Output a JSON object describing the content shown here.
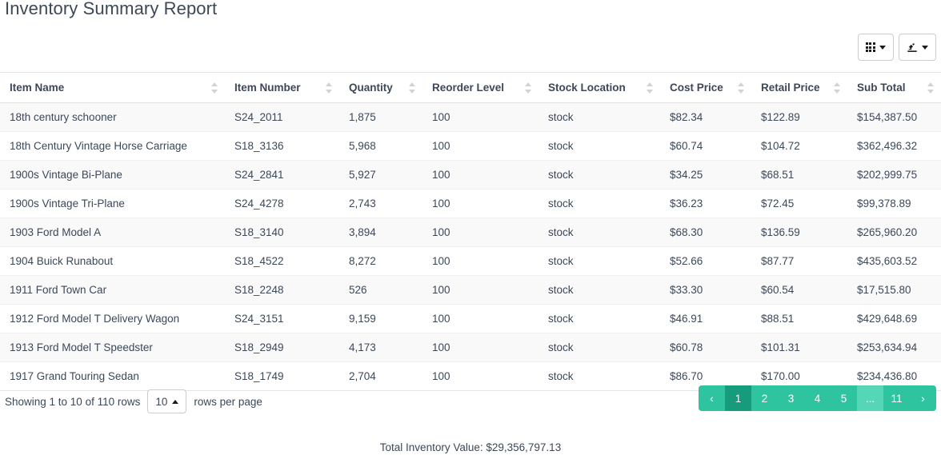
{
  "page_title": "Inventory Summary Report",
  "toolbar": {
    "columns_button": {
      "icon": "grid-icon",
      "caret": "chevron-down-icon"
    },
    "export_button": {
      "icon": "export-icon",
      "caret": "chevron-down-icon"
    }
  },
  "table": {
    "columns": [
      "Item Name",
      "Item Number",
      "Quantity",
      "Reorder Level",
      "Stock Location",
      "Cost Price",
      "Retail Price",
      "Sub Total"
    ],
    "rows": [
      [
        "18th century schooner",
        "S24_2011",
        "1,875",
        "100",
        "stock",
        "$82.34",
        "$122.89",
        "$154,387.50"
      ],
      [
        "18th Century Vintage Horse Carriage",
        "S18_3136",
        "5,968",
        "100",
        "stock",
        "$60.74",
        "$104.72",
        "$362,496.32"
      ],
      [
        "1900s Vintage Bi-Plane",
        "S24_2841",
        "5,927",
        "100",
        "stock",
        "$34.25",
        "$68.51",
        "$202,999.75"
      ],
      [
        "1900s Vintage Tri-Plane",
        "S24_4278",
        "2,743",
        "100",
        "stock",
        "$36.23",
        "$72.45",
        "$99,378.89"
      ],
      [
        "1903 Ford Model A",
        "S18_3140",
        "3,894",
        "100",
        "stock",
        "$68.30",
        "$136.59",
        "$265,960.20"
      ],
      [
        "1904 Buick Runabout",
        "S18_4522",
        "8,272",
        "100",
        "stock",
        "$52.66",
        "$87.77",
        "$435,603.52"
      ],
      [
        "1911 Ford Town Car",
        "S18_2248",
        "526",
        "100",
        "stock",
        "$33.30",
        "$60.54",
        "$17,515.80"
      ],
      [
        "1912 Ford Model T Delivery Wagon",
        "S24_3151",
        "9,159",
        "100",
        "stock",
        "$46.91",
        "$88.51",
        "$429,648.69"
      ],
      [
        "1913 Ford Model T Speedster",
        "S18_2949",
        "4,173",
        "100",
        "stock",
        "$60.78",
        "$101.31",
        "$253,634.94"
      ],
      [
        "1917 Grand Touring Sedan",
        "S18_1749",
        "2,704",
        "100",
        "stock",
        "$86.70",
        "$170.00",
        "$234,436.80"
      ]
    ]
  },
  "footer": {
    "showing_text": "Showing 1 to 10 of 110 rows",
    "page_size_value": "10",
    "rows_per_page_label": "rows per page",
    "total_line": "Total Inventory Value: $29,356,797.13"
  },
  "pagination": {
    "prev": "‹",
    "next": "›",
    "ellipsis": "...",
    "pages": [
      "1",
      "2",
      "3",
      "4",
      "5"
    ],
    "last_page": "11",
    "active_page": "1",
    "active_color": "#169b7d",
    "base_color": "#2ec4a0",
    "ellipsis_color": "#55d7b7"
  }
}
